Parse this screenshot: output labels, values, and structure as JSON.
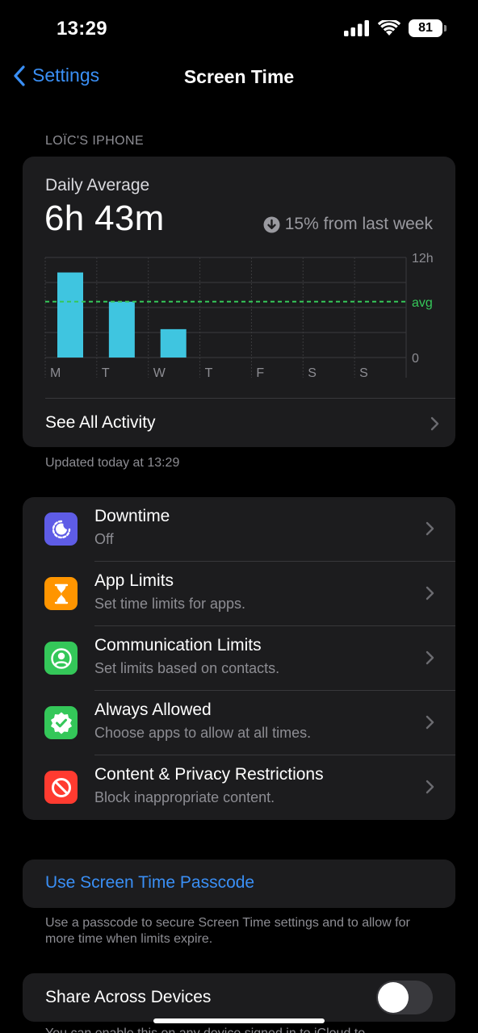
{
  "status_bar": {
    "time": "13:29",
    "battery": "81"
  },
  "nav": {
    "back_label": "Settings",
    "title": "Screen Time"
  },
  "device_header": "LOÏC'S IPHONE",
  "summary": {
    "label": "Daily Average",
    "value": "6h 43m",
    "trend": "15% from last week",
    "see_all": "See All Activity"
  },
  "chart_data": {
    "type": "bar",
    "categories": [
      "M",
      "T",
      "W",
      "T",
      "F",
      "S",
      "S"
    ],
    "values": [
      10.2,
      6.7,
      3.4,
      0,
      0,
      0,
      0
    ],
    "average": 6.7,
    "ylim": [
      0,
      12
    ],
    "y_ticks": [
      "12h",
      "avg",
      "0"
    ],
    "bar_color": "#3fc5e0",
    "avg_color": "#35c759"
  },
  "updated": "Updated today at 13:29",
  "items": [
    {
      "title": "Downtime",
      "subtitle": "Off",
      "color": "#5e5ce6",
      "icon": "downtime-icon"
    },
    {
      "title": "App Limits",
      "subtitle": "Set time limits for apps.",
      "color": "#ff9500",
      "icon": "hourglass-icon"
    },
    {
      "title": "Communication Limits",
      "subtitle": "Set limits based on contacts.",
      "color": "#34c759",
      "icon": "person-circle-icon"
    },
    {
      "title": "Always Allowed",
      "subtitle": "Choose apps to allow at all times.",
      "color": "#34c759",
      "icon": "checkmark-seal-icon"
    },
    {
      "title": "Content & Privacy Restrictions",
      "subtitle": "Block inappropriate content.",
      "color": "#ff3b30",
      "icon": "prohibited-icon"
    }
  ],
  "passcode": {
    "label": "Use Screen Time Passcode",
    "footnote": "Use a passcode to secure Screen Time settings and to allow for more time when limits expire."
  },
  "share": {
    "label": "Share Across Devices",
    "enabled": false,
    "footnote": "You can enable this on any device signed in to iCloud to"
  }
}
